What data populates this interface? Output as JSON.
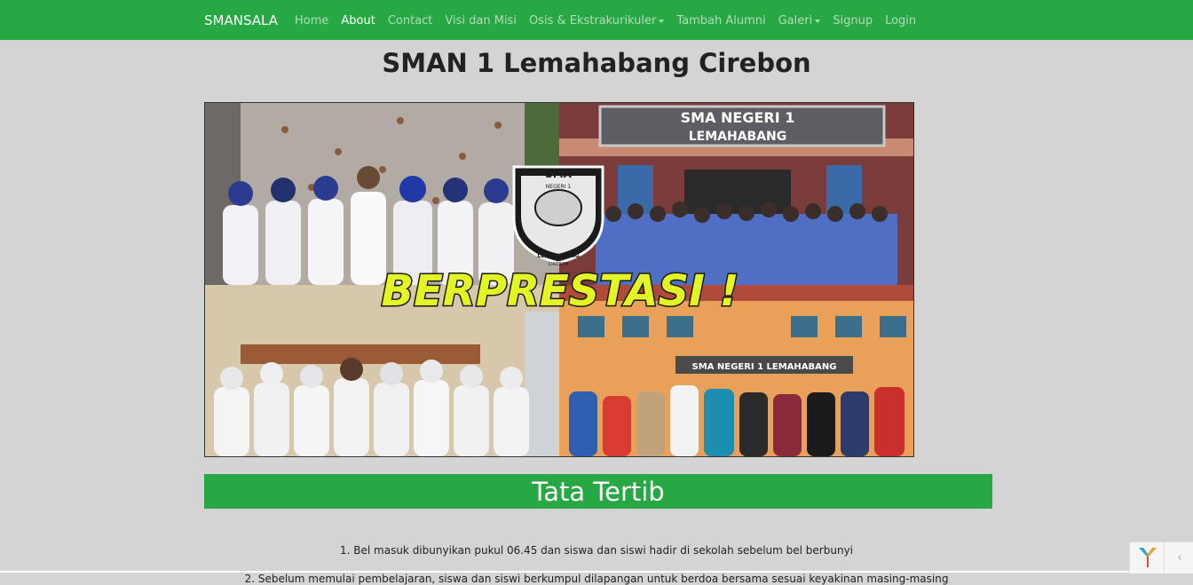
{
  "nav": {
    "brand": "SMANSALA",
    "links": [
      "Home",
      "About",
      "Contact",
      "Visi dan Misi",
      "Osis & Ekstrakurikuler",
      "Tambah Alumni",
      "Galeri",
      "Signup",
      "Login"
    ]
  },
  "page_title": "SMAN 1 Lemahabang Cirebon",
  "banner": {
    "sign_line1": "SMA NEGERI 1",
    "sign_line2": "LEMAHABANG",
    "headline": "BERPRESTASI !",
    "logo_top": "SMA",
    "logo_sub": "NEGERI 1",
    "logo_bottom1": "LEMAHABANG",
    "logo_bottom2": "CIREBON",
    "bottom_sign": "SMA NEGERI 1 LEMAHABANG"
  },
  "section": {
    "title": "Tata Tertib",
    "rules": [
      "1. Bel masuk dibunyikan pukul 06.45 dan siswa dan siswi hadir di sekolah sebelum bel berbunyi",
      "2. Sebelum memulai pembelajaran, siswa dan siswi berkumpul dilapangan untuk berdoa bersama sesuai keyakinan masing-masing"
    ]
  },
  "colors": {
    "accent": "#28a745",
    "background": "#d4d4d4",
    "banner_text": "#e4f524"
  },
  "icons": {
    "debug_toolbar": "yii-logo-icon",
    "toggle": "chevron-left-icon"
  }
}
